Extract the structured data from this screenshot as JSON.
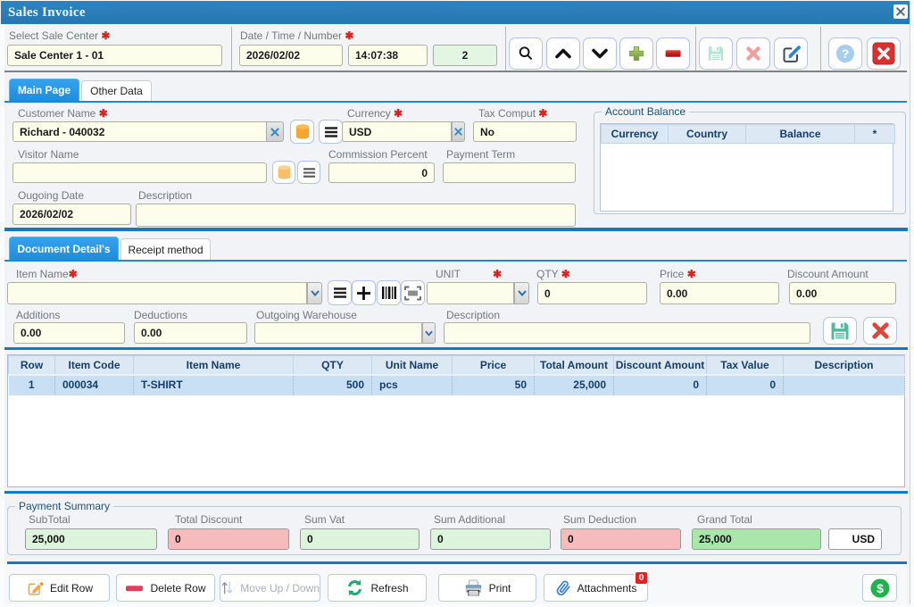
{
  "window": {
    "title": "Sales Invoice"
  },
  "ui": {
    "required_marker": "✱",
    "help_glyph": "?",
    "dollar_glyph": "$"
  },
  "colors": {
    "titlebar": "#2a7db8",
    "active_tab": "#1e96e8",
    "separator_blue": "#1779bd",
    "input_bg": "#fdfdeb",
    "green_box": "#dcf4dc",
    "pink_box": "#f6bcbc",
    "grand_total_green": "#a9e6a9",
    "selected_row": "#c9dff4",
    "badge_red": "#e02424"
  },
  "header": {
    "sale_center": {
      "label": "Select Sale Center",
      "value": "Sale Center 1 - 01"
    },
    "date_time_number": {
      "label": "Date / Time / Number",
      "date": "2026/02/02",
      "time": "14:07:38",
      "number": "2"
    }
  },
  "toolbar": {
    "icons": [
      "search",
      "up",
      "down",
      "add",
      "remove",
      "save",
      "delete",
      "edit",
      "help",
      "close"
    ]
  },
  "tabs_main": [
    {
      "label": "Main Page"
    },
    {
      "label": "Other Data"
    }
  ],
  "fields": {
    "customer": {
      "label": "Customer Name",
      "value": "Richard - 040032"
    },
    "currency": {
      "label": "Currency",
      "value": "USD"
    },
    "tax_comput": {
      "label": "Tax Comput",
      "value": "No"
    },
    "visitor": {
      "label": "Visitor Name",
      "value": ""
    },
    "commission": {
      "label": "Commission Percent",
      "value": "0"
    },
    "payment_term": {
      "label": "Payment Term",
      "value": ""
    },
    "outgoing_date": {
      "label": "Ougoing Date",
      "value": "2026/02/02"
    },
    "description": {
      "label": "Description",
      "value": ""
    }
  },
  "account_balance": {
    "legend": "Account Balance",
    "columns": [
      "Currency",
      "Country",
      "Balance",
      "*"
    ]
  },
  "tabs_detail": [
    {
      "label": "Document Detail's"
    },
    {
      "label": "Receipt method"
    }
  ],
  "item_entry": {
    "item_name_label": "Item Name",
    "unit_label": "UNIT",
    "qty": {
      "label": "QTY",
      "value": "0"
    },
    "price": {
      "label": "Price",
      "value": "0.00"
    },
    "discount": {
      "label": "Discount Amount",
      "value": "0.00"
    },
    "additions": {
      "label": "Additions",
      "value": "0.00"
    },
    "deductions": {
      "label": "Deductions",
      "value": "0.00"
    },
    "warehouse": {
      "label": "Outgoing Warehouse",
      "value": ""
    },
    "description": {
      "label": "Description",
      "value": ""
    }
  },
  "items_table": {
    "columns": [
      "Row",
      "Item Code",
      "Item Name",
      "QTY",
      "Unit Name",
      "Price",
      "Total Amount",
      "Discount Amount",
      "Tax Value",
      "Description"
    ],
    "rows": [
      {
        "row": "1",
        "item_code": "000034",
        "item_name": "T-SHIRT",
        "qty": "500",
        "unit_name": "pcs",
        "price": "50",
        "total_amount": "25,000",
        "discount_amount": "0",
        "tax_value": "0",
        "description": ""
      }
    ]
  },
  "payment_summary": {
    "legend": "Payment Summary",
    "subtotal": {
      "label": "SubTotal",
      "value": "25,000"
    },
    "total_discount": {
      "label": "Total Discount",
      "value": "0"
    },
    "sum_vat": {
      "label": "Sum Vat",
      "value": "0"
    },
    "sum_additional": {
      "label": "Sum Additional",
      "value": "0"
    },
    "sum_deduction": {
      "label": "Sum Deduction",
      "value": "0"
    },
    "grand_total": {
      "label": "Grand Total",
      "value": "25,000"
    },
    "currency": "USD"
  },
  "bottom_bar": {
    "edit_row": "Edit Row",
    "delete_row": "Delete Row",
    "move": "Move Up / Down",
    "refresh": "Refresh",
    "print": "Print",
    "attachments": "Attachments",
    "attachments_count": "0"
  }
}
